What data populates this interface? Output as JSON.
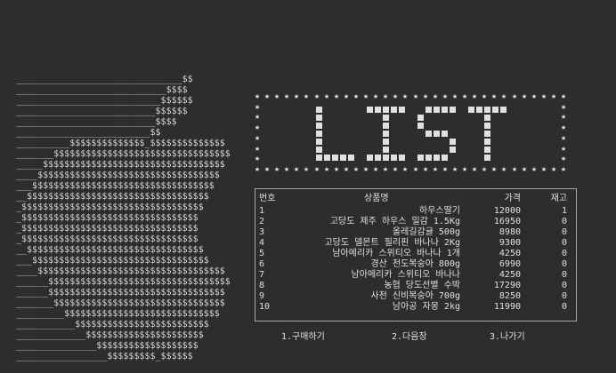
{
  "apple_art": [
    "_______________________________$$",
    "____________________________$$$$",
    "___________________________$$$$$$",
    "__________________________$$$$$$",
    "__________________________$$$$",
    "_________________________$$",
    "__________$$$$$$$$$$$$$$_$$$$$$$$$$$$$$",
    "_______$$$$$$$$$$$$$$$$$$$$$$$$$$$$$$$$$",
    "_____$$$$$$$$$$$$$$$$$$$$$$$$$$$$$$$$$$",
    "____$$$$$$$$$$$$$$$$$$$$$$$$$$$$$$$$$$",
    "___$$$$$$$$$$$$$$$$$$$$$$$$$$$$$$$$$$",
    "__$$$$$$$$$$$$$$$$$$$$$$$$$$$$$$$$$$",
    "_$$$$$$$$$$$$$$$$$$$$$$$$$$$$$$$$$$",
    "_$$$$$$$$$$$$$$$$$$$$$$$$$$$$$$$$$",
    "_$$$$$$$$$$$$$$$$$$$$$$$$$$$$$$$$$",
    "_$$$$$$$$$$$$$$$$$$$$$$$$$$$$$$$$$",
    "__$$$$$$$$$$$$$$$$$$$$$$$$$$$$$$$$$",
    "___$$$$$$$$$$$$$$$$$$$$$$$$$$$$$$$$$",
    "____$$$$$$$$$$$$$$$$$$$$$$$$$$$$$$$$$$$",
    "______$$$$$$$$$$$$$$$$$$$$$$$$$$$$$$$$$$",
    "______$$$$$$$$$$$$$$$$$$$$$$$$$$$$$$$$$",
    "_______$$$$$$$$$$$$$$$$$$$$$$$$$$$$$$$$",
    "_________$$$$$$$$$$$$$$$$$$$$$$$$$$$$$",
    "___________$$$$$$$$$$$$$$$$$$$$$$$$$",
    "_____________$$$$$$$$$$$$$$$$$$$$$$",
    "_______________$$$$$$$$$$$$$$$$$$$",
    "_________________$$$$$$$$$_$$$$$$"
  ],
  "banner_text": "LIST",
  "table": {
    "headers": {
      "no": "번호",
      "name": "상품명",
      "price": "가격",
      "stock": "재고"
    },
    "rows": [
      {
        "no": "1",
        "name": "하우스딸기",
        "price": "12000",
        "stock": "1"
      },
      {
        "no": "2",
        "name": "고당도 제주 하우스 밀감 1.5Kg",
        "price": "16950",
        "stock": "0"
      },
      {
        "no": "3",
        "name": "올레길감귤 500g",
        "price": "8980",
        "stock": "0"
      },
      {
        "no": "4",
        "name": "고당도 델몬트 필리핀 바나나 2Kg",
        "price": "9300",
        "stock": "0"
      },
      {
        "no": "5",
        "name": "남아메리카 스위티오 바나나 1개",
        "price": "4250",
        "stock": "0"
      },
      {
        "no": "6",
        "name": "경산 천도복숭아 800g",
        "price": "6990",
        "stock": "0"
      },
      {
        "no": "7",
        "name": "남아메리카 스위티오 바나나",
        "price": "4250",
        "stock": "0"
      },
      {
        "no": "8",
        "name": "농협 당도선별 수박",
        "price": "17290",
        "stock": "0"
      },
      {
        "no": "9",
        "name": "사천 신비복숭아 700g",
        "price": "8250",
        "stock": "0"
      },
      {
        "no": "10",
        "name": "남아공 자몽 2kg",
        "price": "11990",
        "stock": "0"
      }
    ]
  },
  "menu": {
    "buy": "1.구매하기",
    "next": "2.다음장",
    "exit": "3.나가기"
  }
}
